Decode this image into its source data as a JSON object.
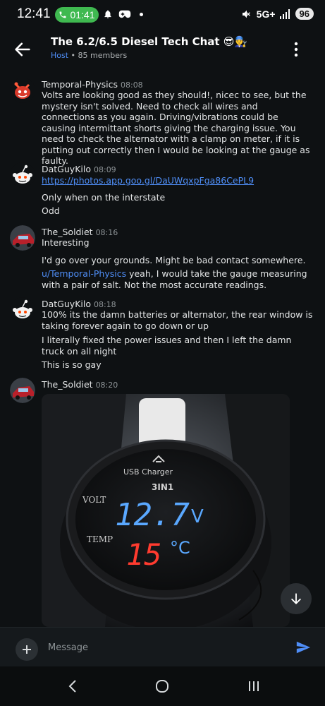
{
  "status_bar": {
    "time": "12:41",
    "call_time": "01:41",
    "network": "5G+",
    "battery": "96"
  },
  "header": {
    "title": "The 6.2/6.5 Diesel Tech Chat 😎👨‍🔧",
    "host_label": "Host",
    "members": " • 85 members"
  },
  "messages": [
    {
      "user": "Temporal-Physics",
      "time": "08:08",
      "lines": [
        "Volts are looking good as they should!, nicec to see, but the mystery isn't solved. Need to check all wires and connections as you again. Driving/vibrations could be causing intermittant shorts giving the charging issue.  You need to check the alternator with a clamp on meter, if it is putting out correctly then I would be looking at the gauge as faulty."
      ]
    },
    {
      "user": "DatGuyKilo",
      "time": "08:09",
      "link": "https://photos.app.goo.gl/DaUWqxpFga86CePL9",
      "lines": [
        "Only when on the interstate",
        "Odd"
      ]
    },
    {
      "user": "The_Soldiet",
      "time": "08:16",
      "lines": [
        "Interesting",
        "I'd go over your grounds. Might be bad contact somewhere."
      ],
      "mention": "u/Temporal-Physics",
      "mention_text": " yeah, I would take the gauge measuring with a pair of salt. Not the most accurate readings."
    },
    {
      "user": "DatGuyKilo",
      "time": "08:18",
      "lines": [
        "100% its the damn batteries or alternator, the rear window is taking forever again to go down or up",
        "I literally fixed the power issues and then I left the damn truck on all night",
        "This is so gay"
      ]
    },
    {
      "user": "The_Soldiet",
      "time": "08:20"
    }
  ],
  "photo": {
    "brand": "USB Charger",
    "model": "3IN1",
    "volt_label": "VOLT",
    "temp_label": "TEMP",
    "volt_value": "12.7",
    "volt_unit": "V",
    "temp_value": "15",
    "temp_unit": "°C"
  },
  "composer": {
    "placeholder": "Message"
  },
  "colors": {
    "background": "#0e1113",
    "accent": "#4f8ef7",
    "call_green": "#3fb950",
    "volt_blue": "#5aa8ff",
    "temp_red": "#ff3b2f"
  }
}
